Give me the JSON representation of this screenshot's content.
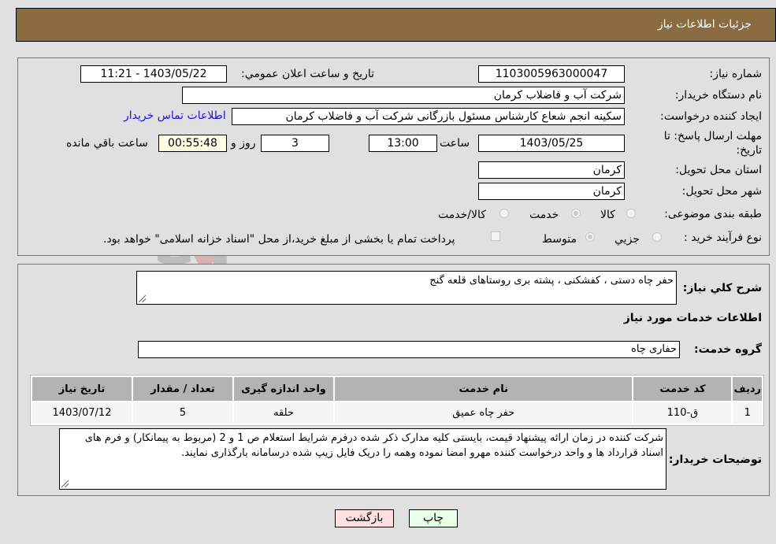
{
  "header": {
    "title": "جزئیات اطلاعات نیاز"
  },
  "fields": {
    "need_number": {
      "label": "شماره نیاز:",
      "value": "1103005963000047"
    },
    "announce_datetime": {
      "label": "تاریخ و ساعت اعلان عمومي:",
      "value": "1403/05/22 - 11:21"
    },
    "buyer_org": {
      "label": "نام دستگاه خریدار:",
      "value": "شرکت آب و فاضلاب کرمان"
    },
    "requester": {
      "label": "ایجاد کننده درخواست:",
      "value": "سکینه انجم شعاع کارشناس مسئول بازرگانی شرکت آب و فاضلاب کرمان"
    },
    "buyer_contact_link": "اطلاعات تماس خریدار",
    "deadline": {
      "label_line1": "مهلت ارسال پاسخ: تا",
      "label_line2": "تاریخ:",
      "date": "1403/05/25",
      "time_label": "ساعت",
      "time": "13:00",
      "days": "3",
      "days_label": "روز و",
      "remaining": "00:55:48",
      "remaining_label": "ساعت باقي مانده"
    },
    "province": {
      "label": "استان محل تحویل:",
      "value": "کرمان"
    },
    "city": {
      "label": "شهر محل تحویل:",
      "value": "کرمان"
    },
    "category": {
      "label": "طبقه بندی موضوعی:",
      "options": [
        "کالا",
        "خدمت",
        "کالا/خدمت"
      ],
      "selected": "خدمت"
    },
    "purchase_type": {
      "label": "نوع فرآیند خرید :",
      "options": [
        "جزيي",
        "متوسط"
      ],
      "selected": "متوسط",
      "treasury_note": "پرداخت تمام یا بخشی از مبلغ خرید،از محل \"اسناد خزانه اسلامی\" خواهد بود."
    }
  },
  "summary": {
    "label": "شرح كلي نياز:",
    "value": "حفر چاه دستی ، کفشکنی ، پشته بری روستاهای قلعه گنج"
  },
  "services_title": "اطلاعات خدمات مورد نياز",
  "service_group": {
    "label": "گروه خدمت:",
    "value": "حفاری چاه"
  },
  "table": {
    "headers": [
      "ردیف",
      "کد خدمت",
      "نام خدمت",
      "واحد اندازه گیری",
      "تعداد / مقدار",
      "تاریخ نیاز"
    ],
    "rows": [
      [
        "1",
        "ق-110",
        "حفر چاه عمیق",
        "حلقه",
        "5",
        "1403/07/12"
      ]
    ]
  },
  "buyer_notes": {
    "label": "توضیحات خریدار:",
    "value": "شرکت کننده در زمان ارائه پیشنهاد قیمت، بایستی کلیه مدارک ذکر شده درفرم شرایط استعلام ص 1  و  2 (مربوط به پیمانکار) و فرم های اسناد قرارداد ها و واحد درخواست کننده مهرو امضا نموده وهمه را دریک فایل زیپ شده درسامانه بارگذاری نمایند."
  },
  "buttons": {
    "print": "چاپ",
    "back": "بازگشت"
  },
  "colors": {
    "header": "#8b6c42",
    "back_button": "#ffe0e0",
    "print_button": "#e8ffe8",
    "link": "#1a10e0"
  }
}
